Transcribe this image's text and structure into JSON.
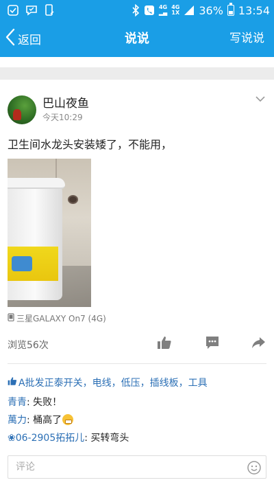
{
  "status_bar": {
    "battery": "36%",
    "time": "13:54",
    "net_top": "4G",
    "net_bottom": "1X",
    "net_top2": "4G",
    "battery_level": 0.36
  },
  "nav": {
    "back_label": "返回",
    "title": "说说",
    "action_label": "写说说"
  },
  "post": {
    "author": "巴山夜鱼",
    "time": "今天10:29",
    "text": "卫生间水龙头安装矮了，不能用，",
    "device": "三星GALAXY On7 (4G)",
    "views": "浏览56次"
  },
  "likes": "A批发正泰开关，电线，低压，插线板，工具",
  "comments": [
    {
      "author": "青青",
      "text": ": 失败！"
    },
    {
      "author": "萬力",
      "text": ": 桶高了"
    },
    {
      "author": "❀06-2905拓拓儿",
      "text": ": 买转弯头"
    }
  ],
  "comment_box": {
    "placeholder": "评论"
  },
  "colors": {
    "accent": "#1a9ee6",
    "link": "#2b6fb5"
  }
}
